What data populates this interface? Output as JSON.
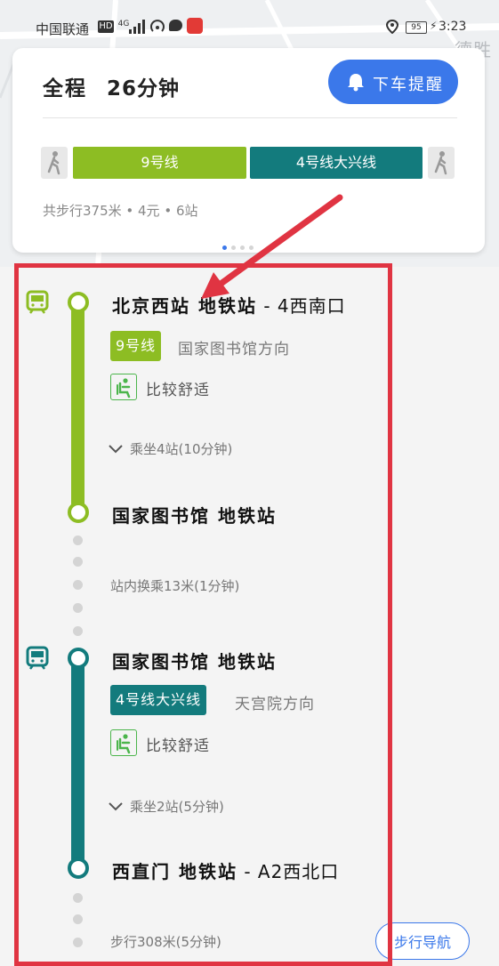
{
  "status_bar": {
    "carrier": "中国联通",
    "hd": "HD",
    "network": "4G",
    "battery": "95",
    "time": "3:23"
  },
  "map": {
    "label": "德胜"
  },
  "summary": {
    "total_label": "全程",
    "total_time": "26分钟",
    "alight_reminder": "下车提醒",
    "segments": [
      {
        "label": "9号线",
        "color": "#8dbd23"
      },
      {
        "label": "4号线大兴线",
        "color": "#137b7d"
      }
    ],
    "meta": "共步行375米 • 4元 • 6站"
  },
  "legs": [
    {
      "station_name": "北京西站 地铁站",
      "station_exit": " - 4西南口",
      "line_tag": "9号线",
      "line_color": "#8dbd23",
      "direction": "国家图书馆方向",
      "comfort": "比较舒适",
      "ride_info": "乘坐4站(10分钟)",
      "end_station": "国家图书馆 地铁站"
    },
    {
      "station_name": "国家图书馆 地铁站",
      "station_exit": "",
      "line_tag": "4号线大兴线",
      "line_color": "#137b7d",
      "direction": "天宫院方向",
      "comfort": "比较舒适",
      "ride_info": "乘坐2站(5分钟)",
      "end_station": "西直门 地铁站",
      "end_exit": " - A2西北口"
    }
  ],
  "transfer_text": "站内换乘13米(1分钟)",
  "walk_text": "步行308米(5分钟)",
  "walk_nav_button": "步行导航",
  "colors": {
    "accent": "#3b78ea",
    "annotation_red": "#e03442"
  }
}
